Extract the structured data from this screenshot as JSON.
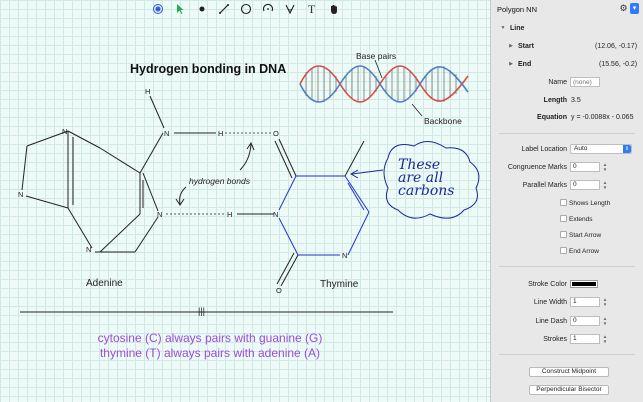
{
  "toolbar": {
    "tools": [
      "point-tool",
      "select-tool",
      "dot-tool",
      "line-tool",
      "circle-tool",
      "arc-tool",
      "angle-tool",
      "text-tool",
      "hand-tool"
    ],
    "text_glyph": "T"
  },
  "diagram": {
    "title": "Hydrogen bonding in DNA",
    "atoms": {
      "h_top": "H",
      "n_amine": "N",
      "h_amine": "H",
      "o_top": "O",
      "n1": "N",
      "n_left": "N",
      "n_mid": "N",
      "h_mid": "H",
      "n_thy": "N",
      "n_bottom": "N",
      "n_thy_bottom": "N",
      "o_bottom": "O"
    },
    "hydrogen_bonds_label": "hydrogen bonds",
    "adenine_label": "Adenine",
    "thymine_label": "Thymine",
    "base_pairs_label": "Base pairs",
    "backbone_label": "Backbone",
    "handwriting": [
      "These",
      "are all",
      "carbons"
    ],
    "tick_marks": "|||",
    "caption_line1": "cytosine (C) always pairs with guanine (G)",
    "caption_line2": "thymine (T) always pairs with adenine (A)"
  },
  "inspector": {
    "title": "Polygon NN",
    "section": "Line",
    "start_label": "Start",
    "start_value": "(12.06, -0.17)",
    "end_label": "End",
    "end_value": "(15.56, -0.2)",
    "name_label": "Name",
    "name_placeholder": "(none)",
    "length_label": "Length",
    "length_value": "3.5",
    "equation_label": "Equation",
    "equation_value": "y = -0.0088x - 0.065",
    "label_location_label": "Label Location",
    "label_location_value": "Auto",
    "congruence_label": "Congruence Marks",
    "congruence_value": "0",
    "parallel_label": "Parallel Marks",
    "parallel_value": "0",
    "shows_length": "Shows Length",
    "extends": "Extends",
    "start_arrow": "Start Arrow",
    "end_arrow": "End Arrow",
    "stroke_color_label": "Stroke Color",
    "stroke_color": "#000000",
    "line_width_label": "Line Width",
    "line_width_value": "1",
    "line_dash_label": "Line Dash",
    "line_dash_value": "0",
    "strokes_label": "Strokes",
    "strokes_value": "1",
    "construct_midpoint": "Construct Midpoint",
    "perpendicular_bisector": "Perpendicular Bisector"
  },
  "colors": {
    "canvas_bg": "#eefaf7",
    "accent": "#2f7cf6",
    "caption": "#9a4ddb",
    "ink_blue": "#1a2a9a",
    "dna_red": "#e04848",
    "dna_blue": "#4a80c8"
  }
}
